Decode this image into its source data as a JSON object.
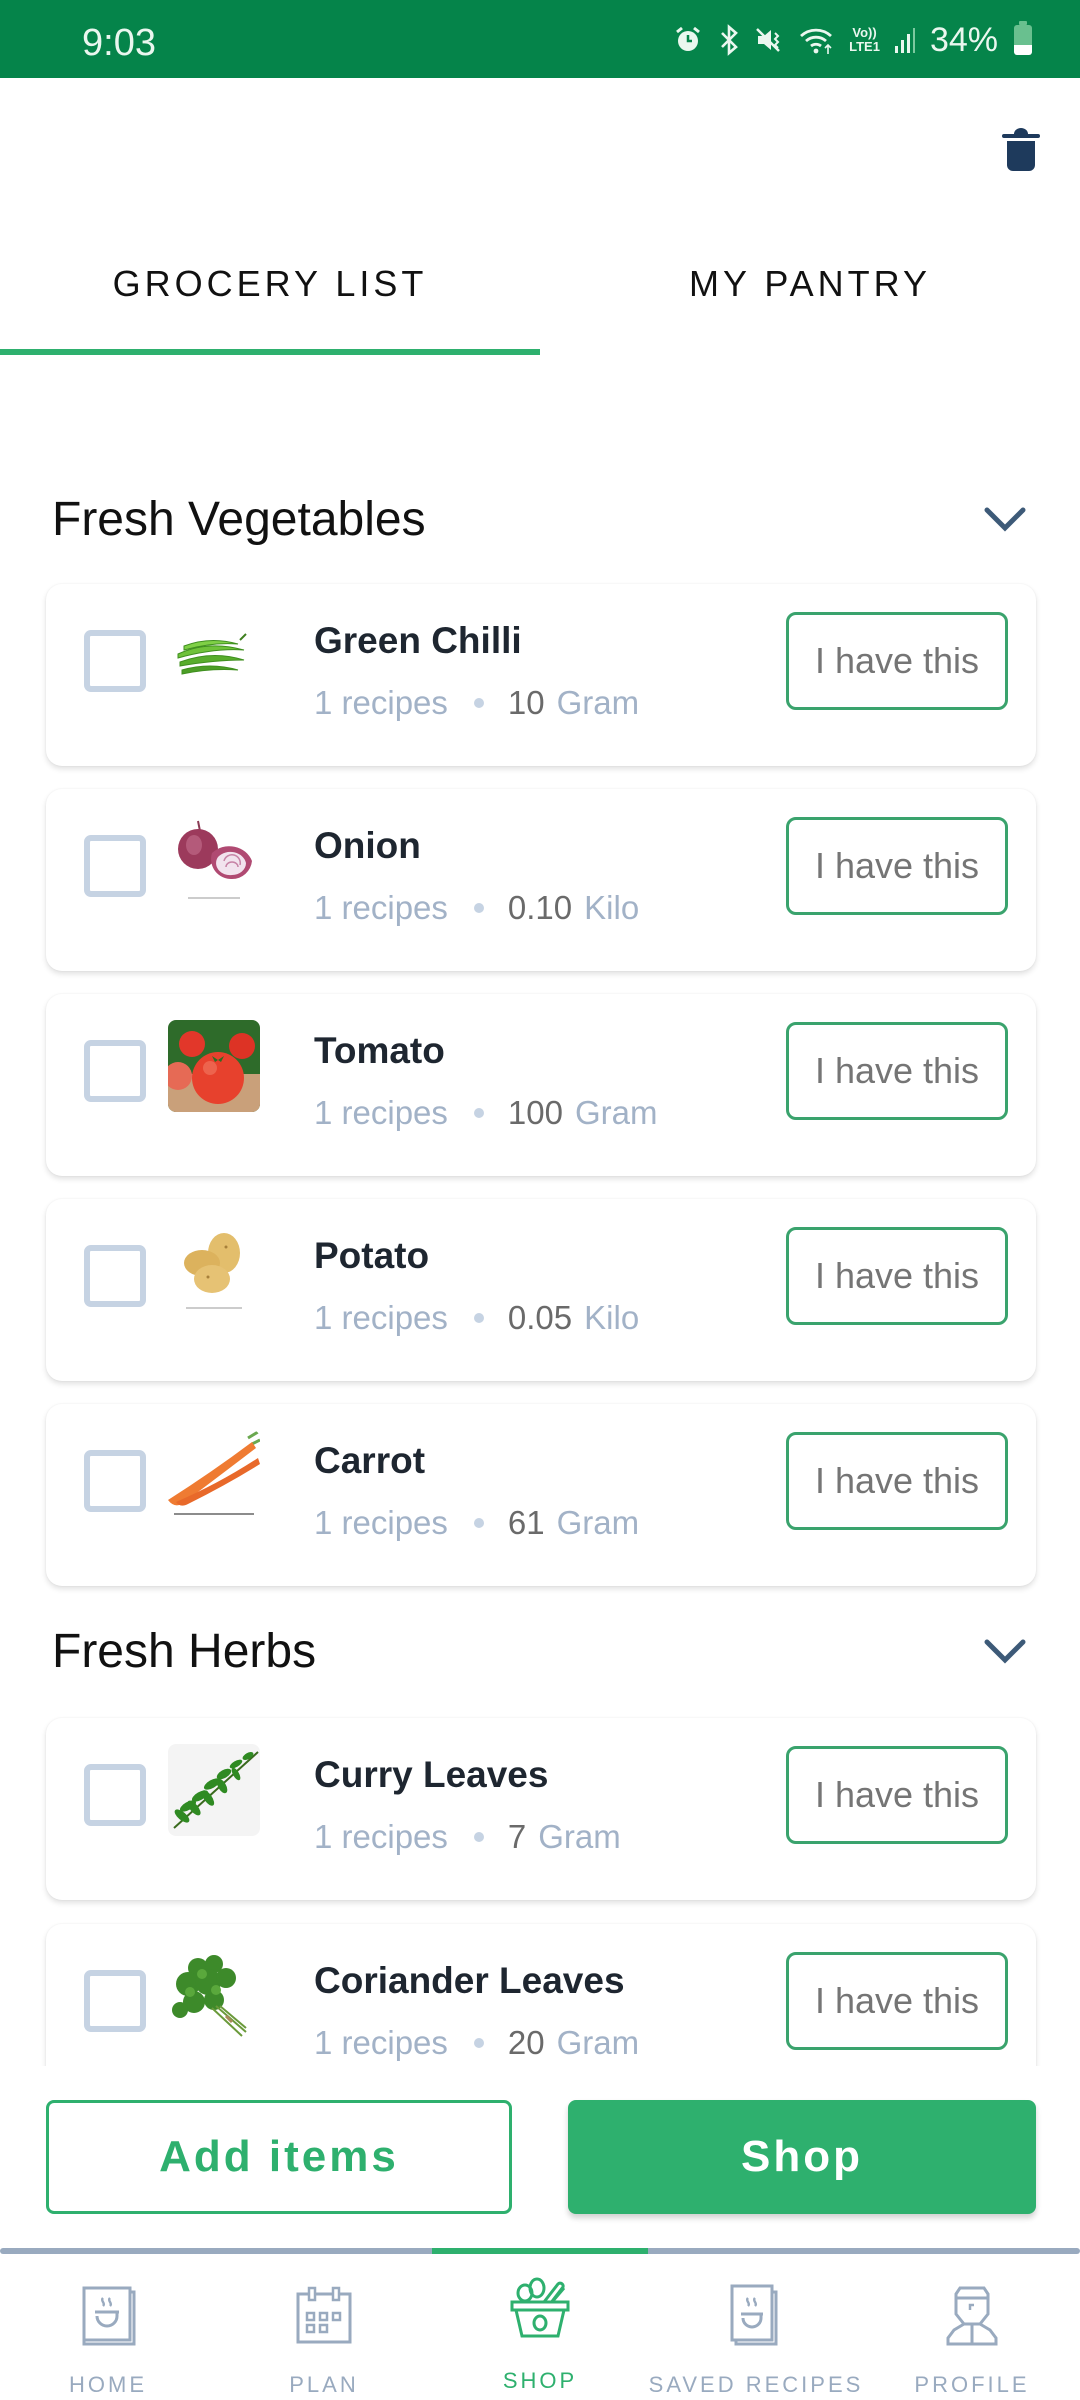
{
  "status_bar": {
    "time": "9:03",
    "icons": [
      "alarm-icon",
      "bluetooth-icon",
      "vibrate-mute-icon",
      "wifi-icon",
      "volte-lte-icon",
      "signal-icon"
    ],
    "lte_top": "Vo))",
    "lte_bottom": "LTE1",
    "battery": "34%"
  },
  "header": {
    "delete_icon": "trash-icon"
  },
  "tabs": [
    {
      "label": "GROCERY LIST",
      "active": true
    },
    {
      "label": "MY PANTRY",
      "active": false
    }
  ],
  "sections": [
    {
      "title": "Fresh Vegetables",
      "expanded": true,
      "items": [
        {
          "name": "Green Chilli",
          "recipes": "1 recipes",
          "quantity": "10",
          "unit": "Gram",
          "image": "green-chilli-image",
          "button": "I have this",
          "checked": false
        },
        {
          "name": "Onion",
          "recipes": "1 recipes",
          "quantity": "0.10",
          "unit": "Kilo",
          "image": "onion-image",
          "button": "I have this",
          "checked": false
        },
        {
          "name": "Tomato",
          "recipes": "1 recipes",
          "quantity": "100",
          "unit": "Gram",
          "image": "tomato-image",
          "button": "I have this",
          "checked": false
        },
        {
          "name": "Potato",
          "recipes": "1 recipes",
          "quantity": "0.05",
          "unit": "Kilo",
          "image": "potato-image",
          "button": "I have this",
          "checked": false
        },
        {
          "name": "Carrot",
          "recipes": "1 recipes",
          "quantity": "61",
          "unit": "Gram",
          "image": "carrot-image",
          "button": "I have this",
          "checked": false
        }
      ]
    },
    {
      "title": "Fresh Herbs",
      "expanded": true,
      "items": [
        {
          "name": "Curry Leaves",
          "recipes": "1 recipes",
          "quantity": "7",
          "unit": "Gram",
          "image": "curry-leaves-image",
          "button": "I have this",
          "checked": false
        },
        {
          "name": "Coriander Leaves",
          "recipes": "1 recipes",
          "quantity": "20",
          "unit": "Gram",
          "image": "coriander-leaves-image",
          "button": "I have this",
          "checked": false
        }
      ]
    }
  ],
  "actions": {
    "add_items": "Add items",
    "shop": "Shop"
  },
  "bottom_nav": [
    {
      "label": "HOME",
      "icon": "recipe-book-icon",
      "active": false
    },
    {
      "label": "PLAN",
      "icon": "calendar-icon",
      "active": false
    },
    {
      "label": "SHOP",
      "icon": "basket-icon",
      "active": true
    },
    {
      "label": "SAVED RECIPES",
      "icon": "saved-recipe-book-icon",
      "active": false
    },
    {
      "label": "PROFILE",
      "icon": "chef-profile-icon",
      "active": false
    }
  ],
  "colors": {
    "status_bar": "#05844A",
    "accent": "#2EB06E",
    "muted": "#99AABF",
    "checkbox_border": "#C6D3E3",
    "icon_dark": "#1E3A5C"
  }
}
